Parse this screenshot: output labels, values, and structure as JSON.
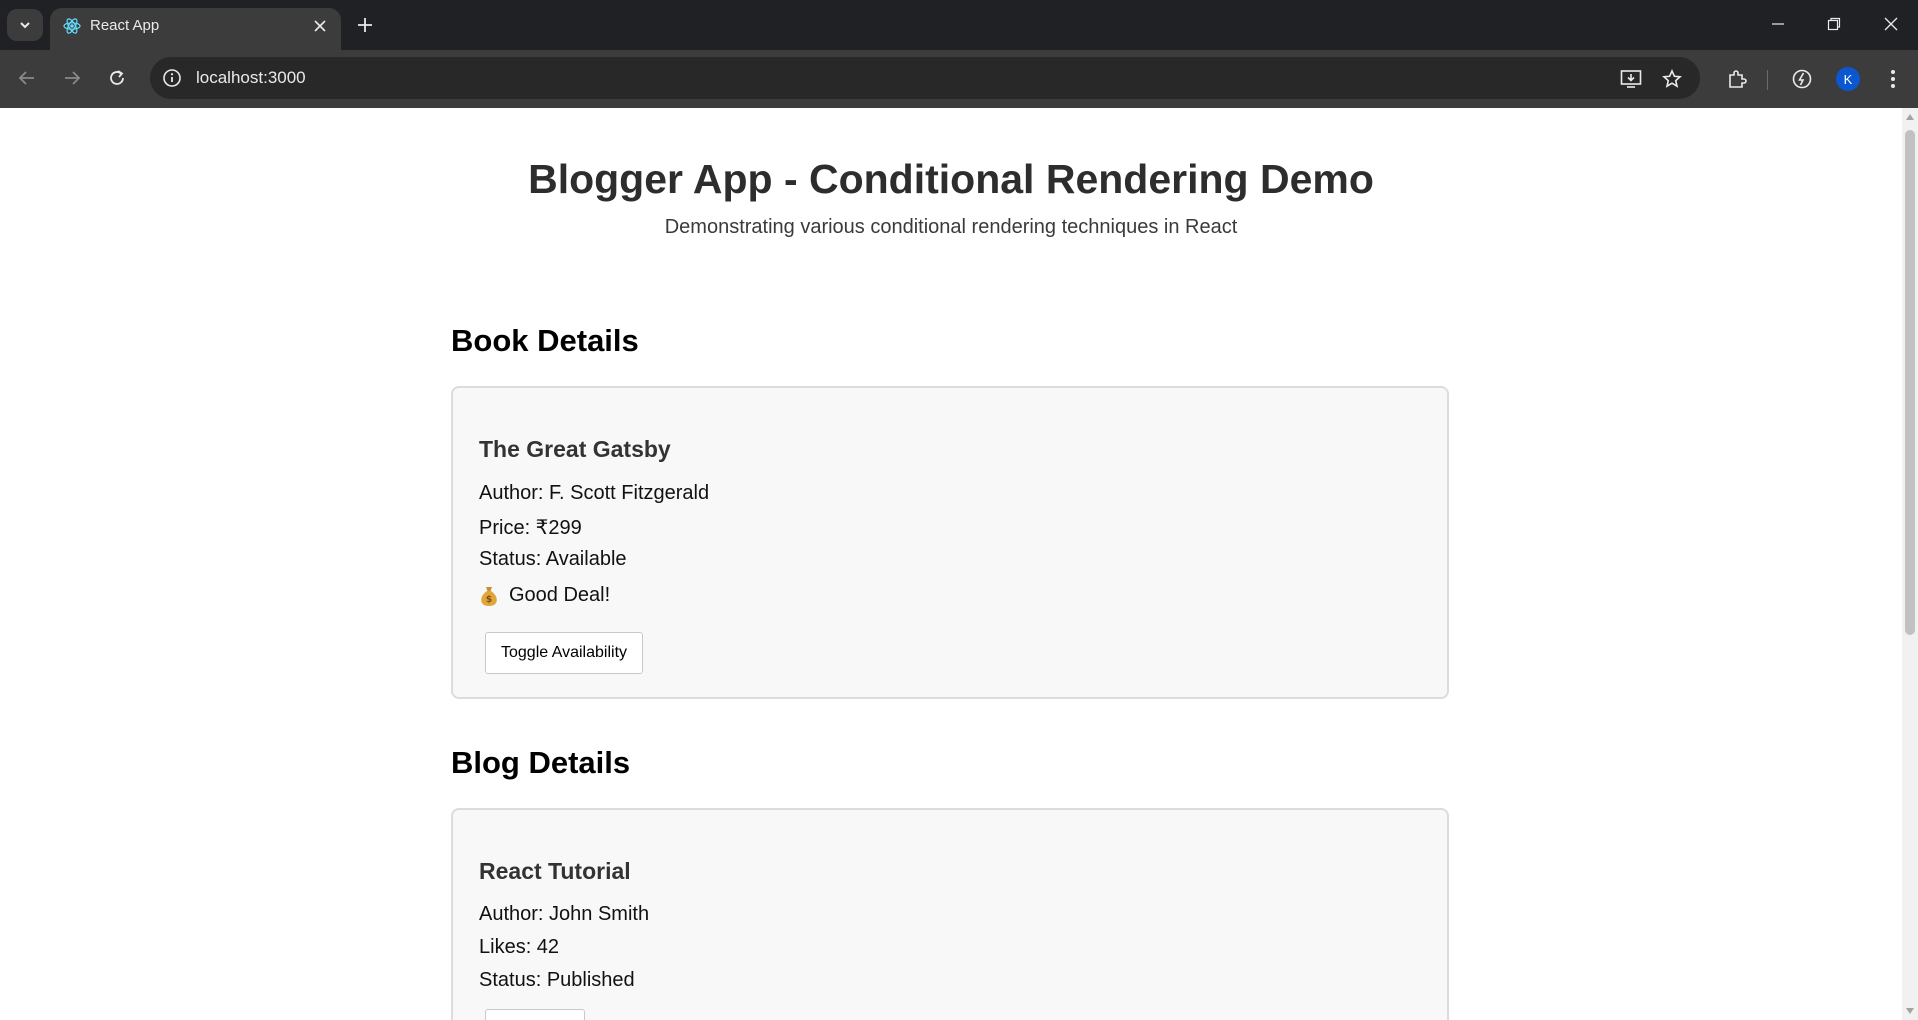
{
  "browser": {
    "tab_title": "React App",
    "url": "localhost:3000",
    "profile_initial": "K",
    "icons": [
      "tab-search-icon",
      "react-favicon-icon",
      "close-icon",
      "plus-icon",
      "minimize-icon",
      "restore-icon",
      "window-close-icon",
      "back-icon",
      "forward-icon",
      "reload-icon",
      "info-icon",
      "install-app-icon",
      "star-icon",
      "extensions-icon",
      "performance-icon",
      "kebab-menu-icon"
    ]
  },
  "page": {
    "title": "Blogger App - Conditional Rendering Demo",
    "subtitle": "Demonstrating various conditional rendering techniques in React"
  },
  "book_section": {
    "heading": "Book Details",
    "title": "The Great Gatsby",
    "author": "Author: F. Scott Fitzgerald",
    "price": "Price: ₹299",
    "status": "Status: Available",
    "deal": "Good Deal!",
    "deal_icon": "money-bag-icon",
    "button": "Toggle Availability"
  },
  "blog_section": {
    "heading": "Blog Details",
    "title": "React Tutorial",
    "author": "Author: John Smith",
    "likes": "Likes: 42",
    "status": "Status: Published"
  },
  "colors": {
    "chrome_dark": "#202124",
    "toolbar": "#3c3c3c",
    "card_bg": "#f8f8f8",
    "card_border": "#dcdcdc",
    "avatar": "#0b57d0"
  }
}
